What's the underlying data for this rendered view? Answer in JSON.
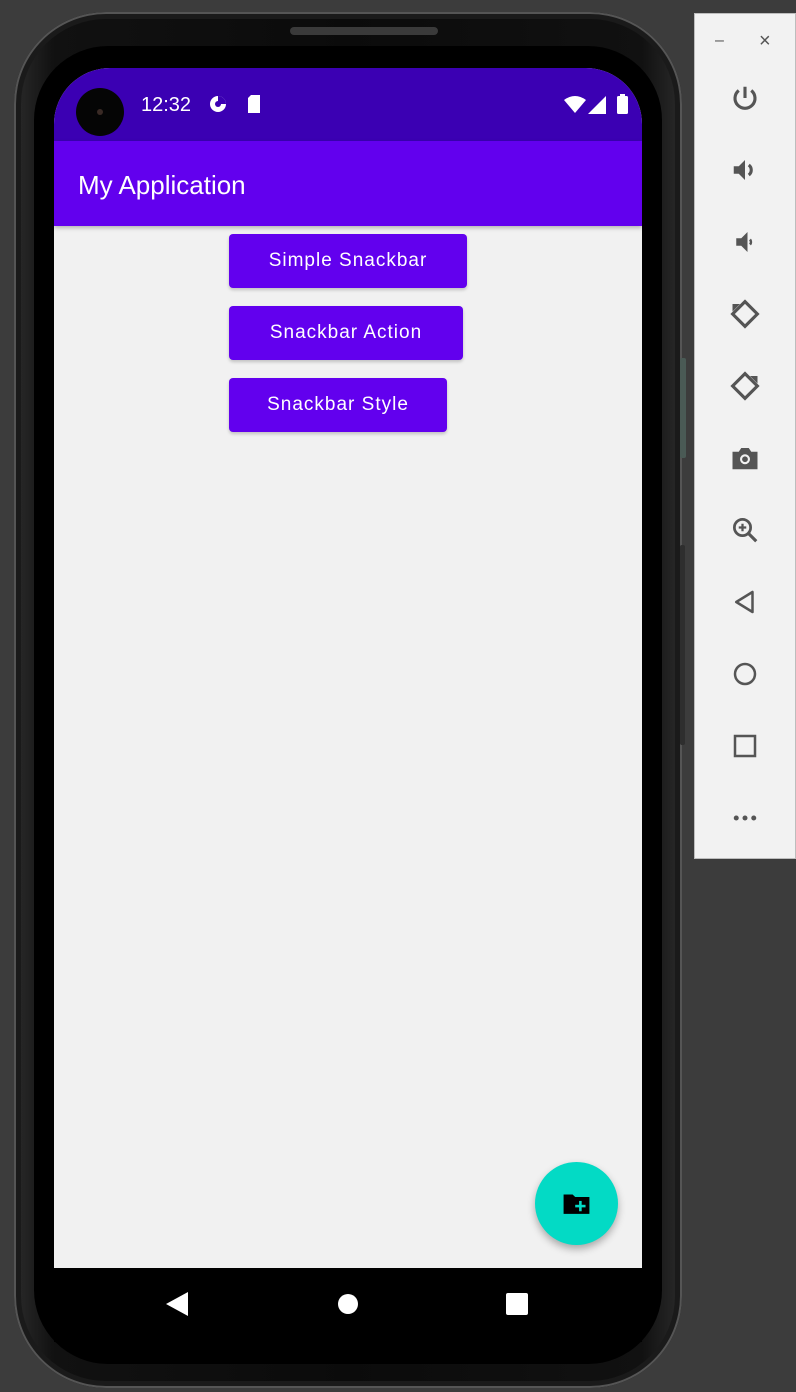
{
  "status_bar": {
    "time": "12:32",
    "left_icons": [
      "data-saver-icon",
      "sd-card-icon"
    ],
    "right_icons": [
      "wifi-icon",
      "signal-icon",
      "battery-icon"
    ]
  },
  "app_bar": {
    "title": "My Application"
  },
  "buttons": {
    "simple": "Simple Snackbar",
    "action": "Snackbar Action",
    "style": "Snackbar Style"
  },
  "fab": {
    "icon": "create-new-folder-icon"
  },
  "nav_bar": {
    "icons": [
      "back-triangle-icon",
      "home-circle-icon",
      "recents-square-icon"
    ]
  },
  "toolbar": {
    "window_controls": {
      "minimize": "–",
      "close": "×"
    },
    "tools": [
      "power-icon",
      "volume-up-icon",
      "volume-down-icon",
      "rotate-left-icon",
      "rotate-right-icon",
      "camera-icon",
      "zoom-in-icon",
      "back-icon",
      "home-icon",
      "overview-icon",
      "more-icon"
    ]
  },
  "colors": {
    "status_bar": "#3b00b3",
    "primary": "#6200ee",
    "fab": "#03dac5",
    "screen_bg": "#f1f1f1"
  }
}
